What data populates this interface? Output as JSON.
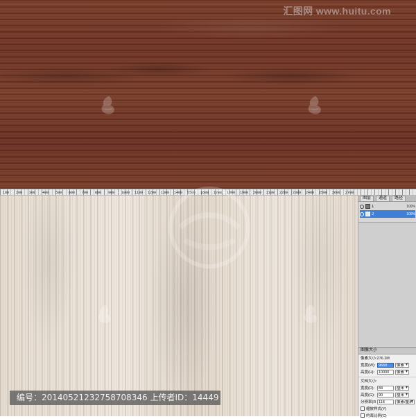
{
  "watermark": {
    "site_text": "汇图网 www.huitu.com"
  },
  "ruler": {
    "labels": [
      "100",
      "200",
      "300",
      "400",
      "500",
      "600",
      "700",
      "800",
      "900",
      "1000",
      "1100",
      "1200",
      "1300",
      "1400",
      "1500",
      "1600",
      "1700",
      "1800",
      "1900",
      "2000",
      "2100",
      "2200",
      "2300",
      "2400",
      "2500",
      "2600",
      "2700"
    ]
  },
  "layers": {
    "tabs": [
      "图层",
      "通道",
      "路径"
    ],
    "rows": [
      {
        "name": "1",
        "opacity": "100%",
        "selected": false
      },
      {
        "name": "2",
        "opacity": "100%",
        "selected": true
      }
    ]
  },
  "image_size_dialog": {
    "title": "图像大小",
    "pixel_dimensions_label": "像素大小:276.2M",
    "width_label": "宽度(W):",
    "width_value": "9650",
    "width_unit": "像素",
    "height_label": "高度(H):",
    "height_value": "10000",
    "height_unit": "像素",
    "document_size_label": "文档大小:",
    "doc_width_label": "宽度(D):",
    "doc_width_value": "84",
    "doc_width_unit": "厘米",
    "doc_height_label": "高度(G):",
    "doc_height_value": "90",
    "doc_height_unit": "厘米",
    "resolution_label": "分辨率(R):",
    "resolution_value": "118",
    "resolution_unit": "像素/厘米",
    "checkbox_scale_styles": "缩放样式(Y)",
    "checkbox_constrain": "约束比例(C)"
  },
  "caption": {
    "text": "编号：20140521232758708346 上传者ID：14449"
  }
}
